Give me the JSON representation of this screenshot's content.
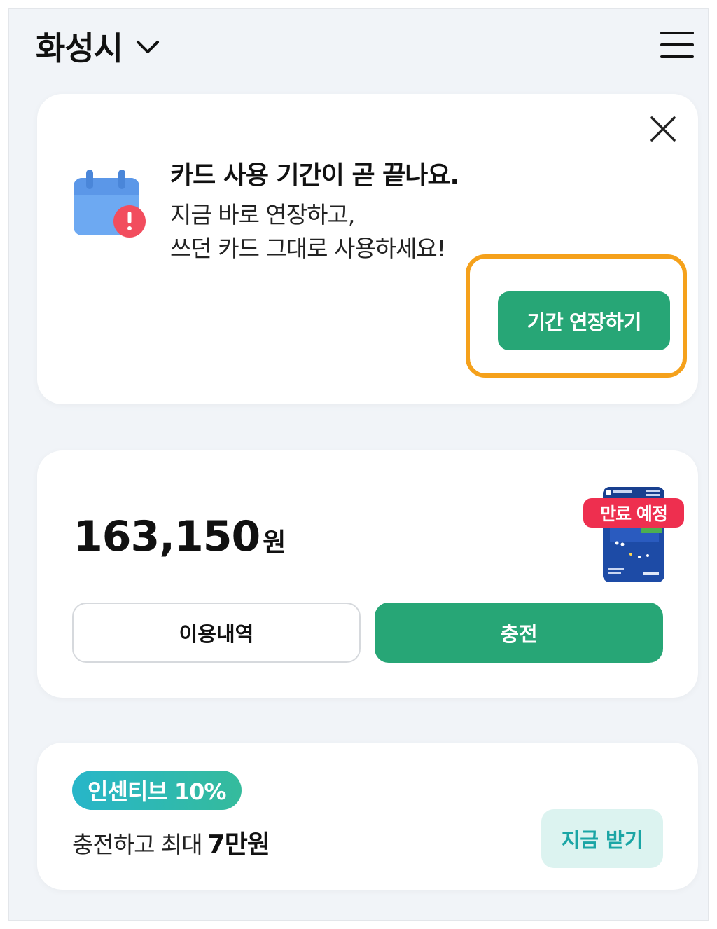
{
  "header": {
    "city": "화성시"
  },
  "expiry_notice": {
    "title": "카드 사용 기간이 곧 끝나요.",
    "line1": "지금 바로 연장하고,",
    "line2": "쓰던 카드 그대로 사용하세요!",
    "extend_label": "기간 연장하기"
  },
  "balance": {
    "amount": "163,150",
    "unit": "원",
    "expire_badge": "만료 예정",
    "history_label": "이용내역",
    "charge_label": "충전"
  },
  "incentive": {
    "badge": "인센티브 10%",
    "text": "충전하고 최대",
    "highlight": "7만원",
    "receive_label": "지금 받기"
  },
  "colors": {
    "accent_green": "#27a676",
    "highlight_orange": "#f5a11b",
    "badge_red": "#ee2f4f",
    "teal_text": "#1aa5a5",
    "background": "#f1f4f8"
  },
  "icons": {
    "chevron": "chevron-down-icon",
    "menu": "hamburger-menu-icon",
    "close": "close-icon",
    "calendar": "calendar-alert-icon"
  }
}
